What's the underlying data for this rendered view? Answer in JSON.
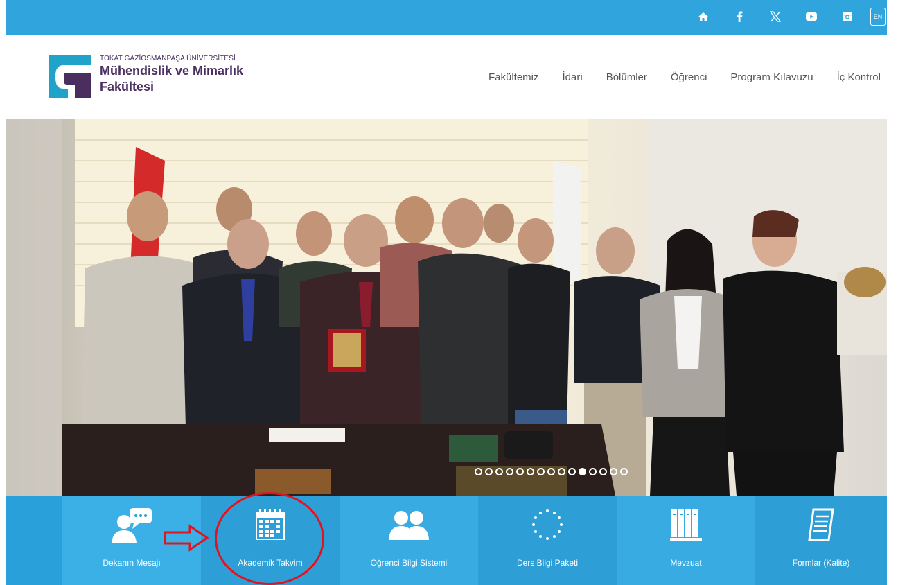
{
  "topbar": {
    "icons": [
      "home-icon",
      "facebook-icon",
      "x-twitter-icon",
      "youtube-icon",
      "instagram-icon"
    ],
    "lang_label": "EN"
  },
  "header": {
    "university": "TOKAT GAZİOSMANPAŞA ÜNİVERSİTESİ",
    "faculty_line1": "Mühendislik ve Mimarlık",
    "faculty_line2": "Fakültesi",
    "nav": [
      "Fakültemiz",
      "İdari",
      "Bölümler",
      "Öğrenci",
      "Program Kılavuzu",
      "İç Kontrol"
    ]
  },
  "slider": {
    "slide_count": 15,
    "active_index": 10
  },
  "quick_links": [
    {
      "label": "Dekanın Mesajı",
      "icon": "speech-person-icon"
    },
    {
      "label": "Akademik Takvim",
      "icon": "calendar-icon"
    },
    {
      "label": "Öğrenci Bilgi Sistemi",
      "icon": "users-icon"
    },
    {
      "label": "Ders Bilgi Paketi",
      "icon": "eu-stars-icon"
    },
    {
      "label": "Mevzuat",
      "icon": "books-icon"
    },
    {
      "label": "Formlar (Kalite)",
      "icon": "document-icon"
    }
  ],
  "colors": {
    "topbar": "#2fa4dd",
    "quickbar": "#2aa0da",
    "logo_purple": "#4a2e5f",
    "logo_teal": "#1fa3c9",
    "annotation_red": "#e0141e"
  }
}
